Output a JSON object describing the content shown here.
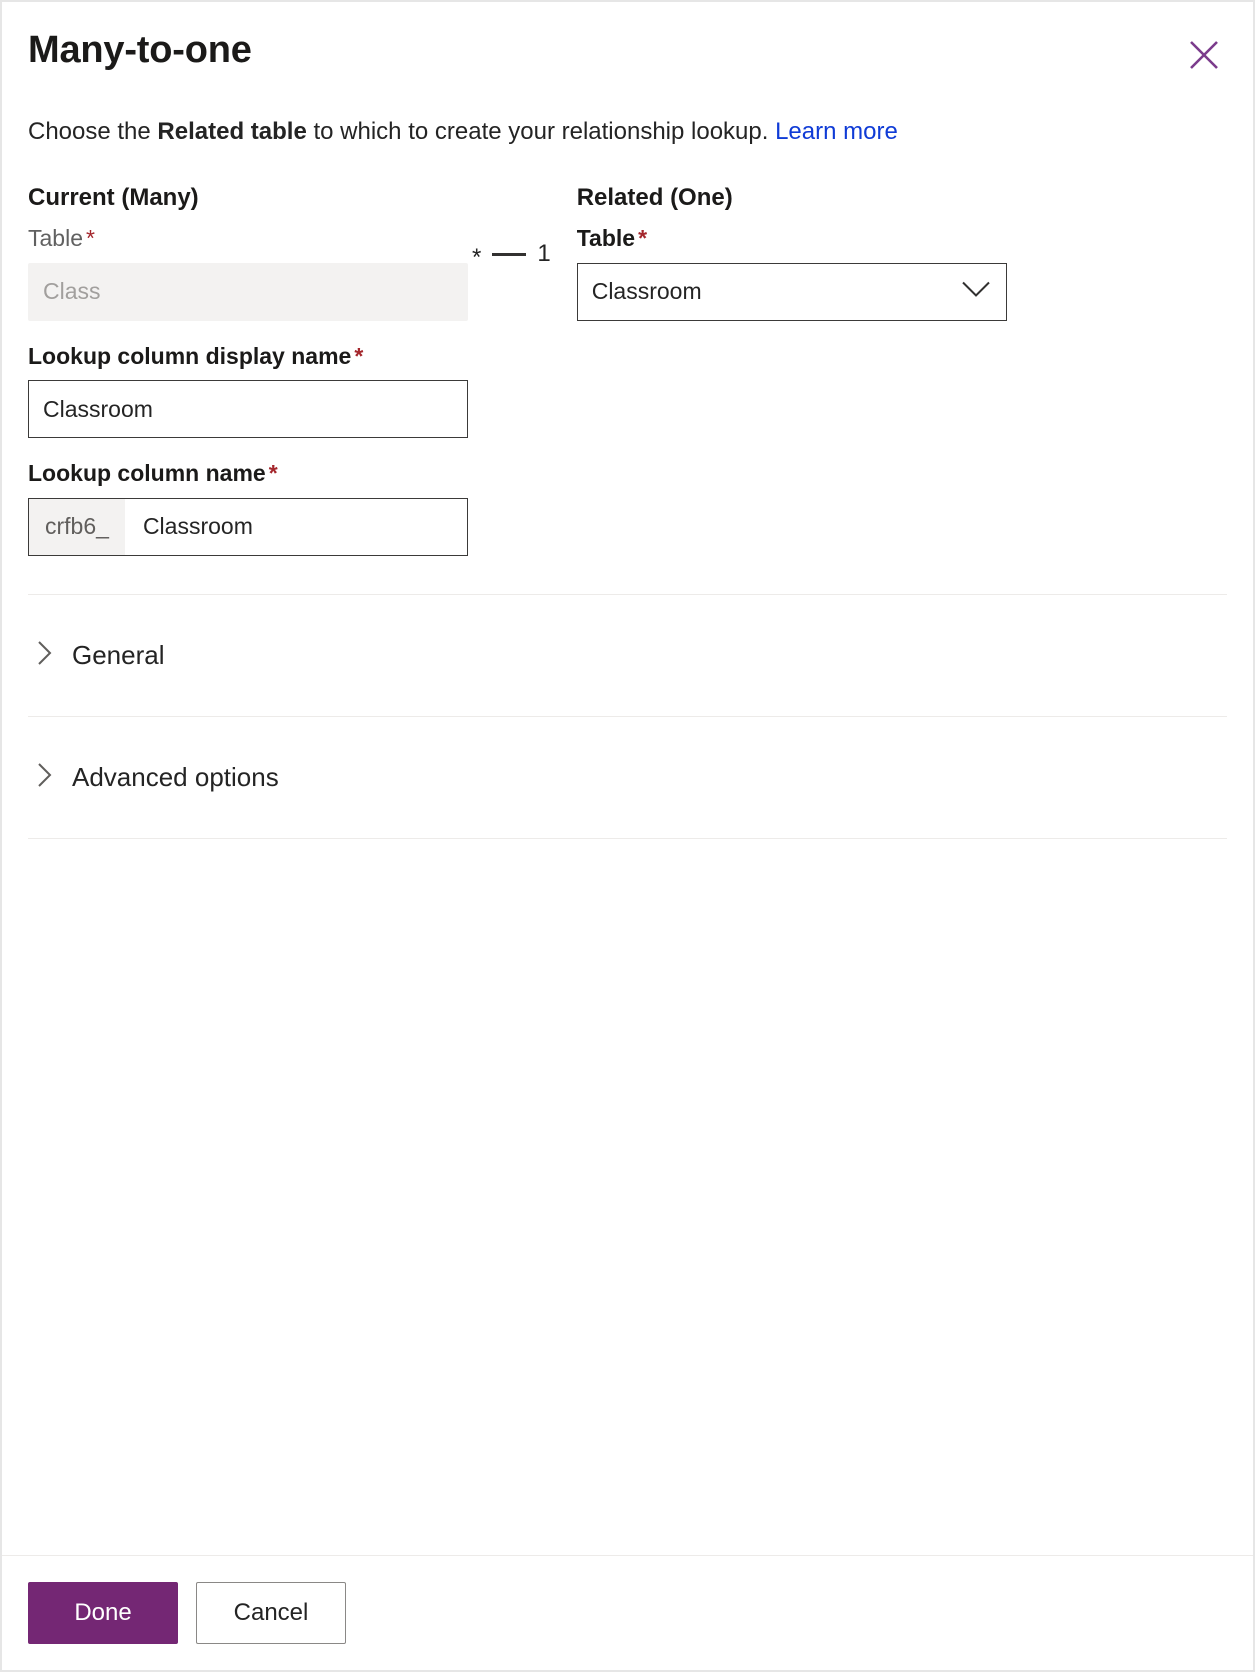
{
  "dialog": {
    "title": "Many-to-one",
    "close_icon": "close-icon",
    "intro": {
      "before": "Choose the ",
      "bold": "Related table",
      "after": " to which to create your relationship lookup. ",
      "link": "Learn more",
      "link_color": "#0f3bd6"
    }
  },
  "current_many": {
    "heading": "Current (Many)",
    "table_label": "Table",
    "required_mark": "*",
    "table_value": "Class",
    "table_disabled": true
  },
  "related_one": {
    "heading": "Related (One)",
    "table_label": "Table",
    "required_mark": "*",
    "table_value": "Classroom",
    "dropdown_icon": "chevron-down-icon"
  },
  "relationship": {
    "many_symbol": "*",
    "one_symbol": "1"
  },
  "lookup_display_name": {
    "label": "Lookup column display name",
    "required_mark": "*",
    "value": "Classroom"
  },
  "lookup_name": {
    "label": "Lookup column name",
    "required_mark": "*",
    "prefix": "crfb6_",
    "value": "Classroom"
  },
  "sections": [
    {
      "label": "General",
      "icon": "chevron-right-icon",
      "expanded": false
    },
    {
      "label": "Advanced options",
      "icon": "chevron-right-icon",
      "expanded": false
    }
  ],
  "footer": {
    "primary_label": "Done",
    "secondary_label": "Cancel",
    "primary_color": "#742774"
  }
}
